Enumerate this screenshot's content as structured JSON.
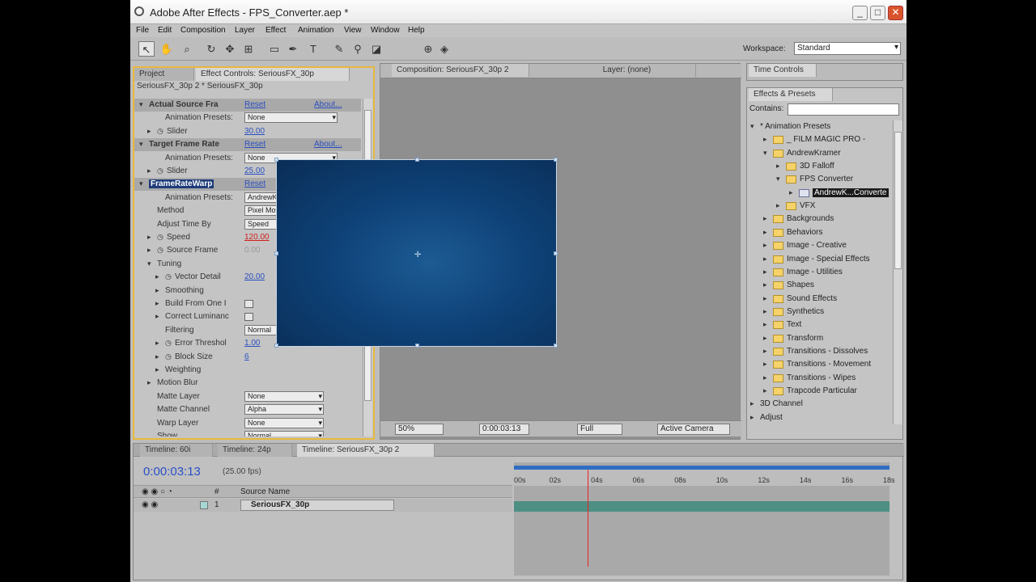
{
  "window": {
    "title": "Adobe After Effects - FPS_Converter.aep *",
    "controls": [
      "_",
      "□",
      "✕"
    ]
  },
  "menu": [
    "File",
    "Edit",
    "Composition",
    "Layer",
    "Effect",
    "Animation",
    "View",
    "Window",
    "Help"
  ],
  "toolbar": {
    "workspace_label": "Workspace:",
    "workspace_value": "Standard"
  },
  "effect_panel": {
    "tabs": [
      "Project",
      "Effect Controls: SeriousFX_30p"
    ],
    "breadcrumb": "SeriousFX_30p 2 * SeriousFX_30p",
    "reset_label": "Reset",
    "about_label": "About...",
    "rows": [
      {
        "indent": 0,
        "label": "Actual Source Fra",
        "bold": true,
        "header": true
      },
      {
        "indent": 2,
        "label": "Animation Presets:",
        "dd": "None"
      },
      {
        "indent": 1,
        "label": "Slider",
        "value": "30.00",
        "stopwatch": true
      },
      {
        "indent": 0,
        "label": "Target Frame Rate",
        "bold": true,
        "header": true
      },
      {
        "indent": 2,
        "label": "Animation Presets:",
        "dd": "None"
      },
      {
        "indent": 1,
        "label": "Slider",
        "value": "25.00",
        "stopwatch": true
      },
      {
        "indent": 0,
        "label": "FrameRateWarp",
        "bold": true,
        "header": true,
        "highlight": true
      },
      {
        "indent": 2,
        "label": "Animation Presets:",
        "dd": "AndrewKramer_Frami"
      },
      {
        "indent": 1,
        "label": "Method",
        "dd": "Pixel Motion"
      },
      {
        "indent": 1,
        "label": "Adjust Time By",
        "dd": "Speed"
      },
      {
        "indent": 1,
        "label": "Speed",
        "value": "120.00",
        "red": true,
        "stopwatch": true
      },
      {
        "indent": 1,
        "label": "Source Frame",
        "value": "0.00",
        "grey": true,
        "stopwatch": true
      },
      {
        "indent": 1,
        "label": "Tuning",
        "open": true
      },
      {
        "indent": 2,
        "label": "Vector Detail",
        "value": "20.00",
        "stopwatch": true
      },
      {
        "indent": 2,
        "label": "Smoothing"
      },
      {
        "indent": 2,
        "label": "Build From One I",
        "check": true
      },
      {
        "indent": 2,
        "label": "Correct Luminanc",
        "check": true
      },
      {
        "indent": 2,
        "label": "Filtering",
        "dd": "Normal"
      },
      {
        "indent": 2,
        "label": "Error Threshol",
        "value": "1.00",
        "stopwatch": true
      },
      {
        "indent": 2,
        "label": "Block Size",
        "value": "6",
        "stopwatch": true
      },
      {
        "indent": 2,
        "label": "Weighting"
      },
      {
        "indent": 1,
        "label": "Motion Blur"
      },
      {
        "indent": 1,
        "label": "Matte Layer",
        "dd": "None"
      },
      {
        "indent": 1,
        "label": "Matte Channel",
        "dd": "Alpha"
      },
      {
        "indent": 1,
        "label": "Warp Layer",
        "dd": "None"
      },
      {
        "indent": 1,
        "label": "Show",
        "dd": "Normal"
      }
    ]
  },
  "composition": {
    "tab": "Composition: SeriousFX_30p 2",
    "layer_tab": "Layer: (none)",
    "zoom": "50%",
    "timecode": "0:00:03:13",
    "resolution": "Full",
    "camera": "Active Camera"
  },
  "time_controls": {
    "tab": "Time Controls"
  },
  "effects_presets": {
    "tab": "Effects & Presets",
    "contains_label": "Contains:",
    "tree": [
      {
        "level": 0,
        "label": "* Animation Presets",
        "open": true,
        "folder": false
      },
      {
        "level": 1,
        "label": "_ FILM MAGIC PRO -",
        "open": false
      },
      {
        "level": 1,
        "label": "AndrewKramer",
        "open": true
      },
      {
        "level": 2,
        "label": "3D Falloff",
        "open": false
      },
      {
        "level": 2,
        "label": "FPS Converter",
        "open": true
      },
      {
        "level": 3,
        "label": "AndrewK...Converte",
        "selected": true,
        "preset": true
      },
      {
        "level": 2,
        "label": "VFX",
        "open": false
      },
      {
        "level": 1,
        "label": "Backgrounds"
      },
      {
        "level": 1,
        "label": "Behaviors"
      },
      {
        "level": 1,
        "label": "Image - Creative"
      },
      {
        "level": 1,
        "label": "Image - Special Effects"
      },
      {
        "level": 1,
        "label": "Image - Utilities"
      },
      {
        "level": 1,
        "label": "Shapes"
      },
      {
        "level": 1,
        "label": "Sound Effects"
      },
      {
        "level": 1,
        "label": "Synthetics"
      },
      {
        "level": 1,
        "label": "Text"
      },
      {
        "level": 1,
        "label": "Transform"
      },
      {
        "level": 1,
        "label": "Transitions - Dissolves"
      },
      {
        "level": 1,
        "label": "Transitions - Movement"
      },
      {
        "level": 1,
        "label": "Transitions - Wipes"
      },
      {
        "level": 1,
        "label": "Trapcode Particular"
      },
      {
        "level": 0,
        "label": "3D Channel",
        "folder": false
      },
      {
        "level": 0,
        "label": "Adjust",
        "folder": false
      }
    ]
  },
  "timeline": {
    "tabs": [
      "Timeline: 60i",
      "Timeline: 24p",
      "Timeline: SeriousFX_30p 2"
    ],
    "timecode": "0:00:03:13",
    "fps": "(25.00 fps)",
    "col_number": "#",
    "col_source": "Source Name",
    "layer": {
      "num": "1",
      "name": "SeriousFX_30p"
    },
    "ruler": [
      "00s",
      "02s",
      "04s",
      "06s",
      "08s",
      "10s",
      "12s",
      "14s",
      "16s",
      "18s"
    ],
    "playhead_seconds": 3.52
  }
}
